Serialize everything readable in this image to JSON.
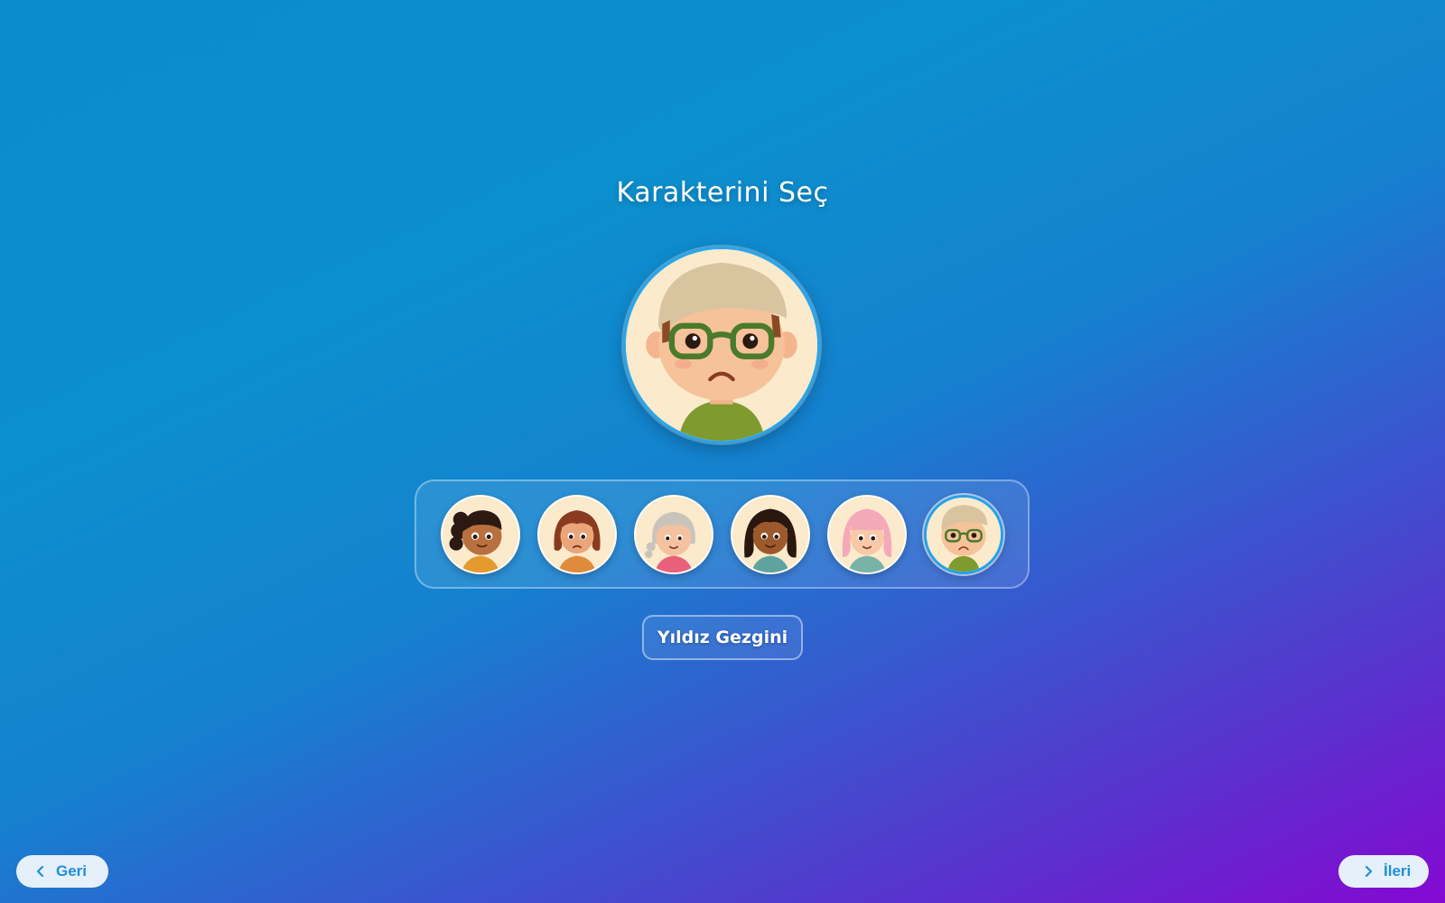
{
  "page": {
    "title": "Karakterini Seç",
    "selected_name": "Yıldız Gezgini"
  },
  "avatars": [
    {
      "name": "avatar-curly-dark-hair",
      "skin": "#b8703e",
      "hair": "#2b1a12",
      "shirt": "#e49a2c"
    },
    {
      "name": "avatar-brown-bob",
      "skin": "#eaa57a",
      "hair": "#8a3a20",
      "shirt": "#e08a3c"
    },
    {
      "name": "avatar-grey-braid",
      "skin": "#f4c2a0",
      "hair": "#c9c4bb",
      "shirt": "#e9607a"
    },
    {
      "name": "avatar-dark-long-hair",
      "skin": "#9c5a2c",
      "hair": "#2a170e",
      "shirt": "#5fa3a0"
    },
    {
      "name": "avatar-pink-hair",
      "skin": "#f7c9a6",
      "hair": "#f4a9b8",
      "shirt": "#79b3a8"
    },
    {
      "name": "avatar-glasses-beige-hair",
      "skin": "#f4c19a",
      "hair": "#d8c3a0",
      "shirt": "#7f9a2e",
      "selected": true
    }
  ],
  "nav": {
    "back_label": "Geri",
    "next_label": "İleri"
  },
  "colors": {
    "accent": "#22a3ea",
    "button_text": "#1f8fd8"
  }
}
